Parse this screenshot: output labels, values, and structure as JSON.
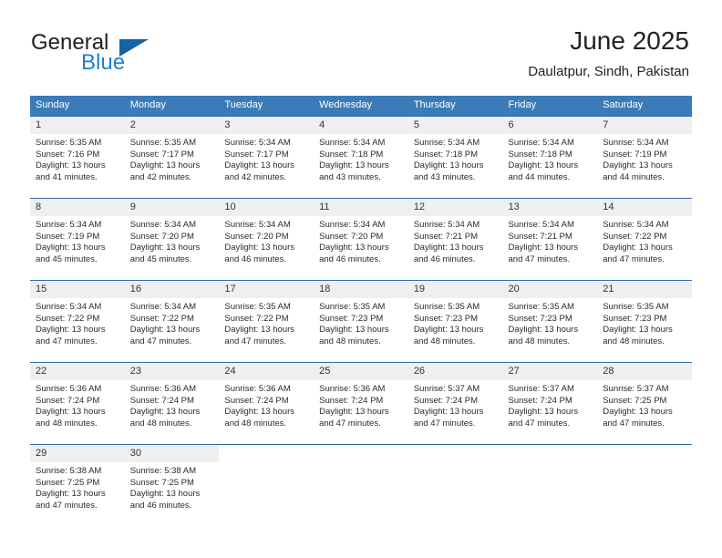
{
  "brand": {
    "name_part1": "General",
    "name_part2": "Blue",
    "triangle_color": "#1464a5",
    "blue_color": "#1f7fd0"
  },
  "header": {
    "title": "June 2025",
    "subtitle": "Daulatpur, Sindh, Pakistan"
  },
  "theme": {
    "header_row_bg": "#3b7cb8",
    "daynum_bg": "#efefef",
    "row_border": "#2f6da8"
  },
  "weekday_headers": [
    "Sunday",
    "Monday",
    "Tuesday",
    "Wednesday",
    "Thursday",
    "Friday",
    "Saturday"
  ],
  "days": [
    {
      "date": "1",
      "sunrise": "Sunrise: 5:35 AM",
      "sunset": "Sunset: 7:16 PM",
      "daylight_line1": "Daylight: 13 hours",
      "daylight_line2": "and 41 minutes."
    },
    {
      "date": "2",
      "sunrise": "Sunrise: 5:35 AM",
      "sunset": "Sunset: 7:17 PM",
      "daylight_line1": "Daylight: 13 hours",
      "daylight_line2": "and 42 minutes."
    },
    {
      "date": "3",
      "sunrise": "Sunrise: 5:34 AM",
      "sunset": "Sunset: 7:17 PM",
      "daylight_line1": "Daylight: 13 hours",
      "daylight_line2": "and 42 minutes."
    },
    {
      "date": "4",
      "sunrise": "Sunrise: 5:34 AM",
      "sunset": "Sunset: 7:18 PM",
      "daylight_line1": "Daylight: 13 hours",
      "daylight_line2": "and 43 minutes."
    },
    {
      "date": "5",
      "sunrise": "Sunrise: 5:34 AM",
      "sunset": "Sunset: 7:18 PM",
      "daylight_line1": "Daylight: 13 hours",
      "daylight_line2": "and 43 minutes."
    },
    {
      "date": "6",
      "sunrise": "Sunrise: 5:34 AM",
      "sunset": "Sunset: 7:18 PM",
      "daylight_line1": "Daylight: 13 hours",
      "daylight_line2": "and 44 minutes."
    },
    {
      "date": "7",
      "sunrise": "Sunrise: 5:34 AM",
      "sunset": "Sunset: 7:19 PM",
      "daylight_line1": "Daylight: 13 hours",
      "daylight_line2": "and 44 minutes."
    },
    {
      "date": "8",
      "sunrise": "Sunrise: 5:34 AM",
      "sunset": "Sunset: 7:19 PM",
      "daylight_line1": "Daylight: 13 hours",
      "daylight_line2": "and 45 minutes."
    },
    {
      "date": "9",
      "sunrise": "Sunrise: 5:34 AM",
      "sunset": "Sunset: 7:20 PM",
      "daylight_line1": "Daylight: 13 hours",
      "daylight_line2": "and 45 minutes."
    },
    {
      "date": "10",
      "sunrise": "Sunrise: 5:34 AM",
      "sunset": "Sunset: 7:20 PM",
      "daylight_line1": "Daylight: 13 hours",
      "daylight_line2": "and 46 minutes."
    },
    {
      "date": "11",
      "sunrise": "Sunrise: 5:34 AM",
      "sunset": "Sunset: 7:20 PM",
      "daylight_line1": "Daylight: 13 hours",
      "daylight_line2": "and 46 minutes."
    },
    {
      "date": "12",
      "sunrise": "Sunrise: 5:34 AM",
      "sunset": "Sunset: 7:21 PM",
      "daylight_line1": "Daylight: 13 hours",
      "daylight_line2": "and 46 minutes."
    },
    {
      "date": "13",
      "sunrise": "Sunrise: 5:34 AM",
      "sunset": "Sunset: 7:21 PM",
      "daylight_line1": "Daylight: 13 hours",
      "daylight_line2": "and 47 minutes."
    },
    {
      "date": "14",
      "sunrise": "Sunrise: 5:34 AM",
      "sunset": "Sunset: 7:22 PM",
      "daylight_line1": "Daylight: 13 hours",
      "daylight_line2": "and 47 minutes."
    },
    {
      "date": "15",
      "sunrise": "Sunrise: 5:34 AM",
      "sunset": "Sunset: 7:22 PM",
      "daylight_line1": "Daylight: 13 hours",
      "daylight_line2": "and 47 minutes."
    },
    {
      "date": "16",
      "sunrise": "Sunrise: 5:34 AM",
      "sunset": "Sunset: 7:22 PM",
      "daylight_line1": "Daylight: 13 hours",
      "daylight_line2": "and 47 minutes."
    },
    {
      "date": "17",
      "sunrise": "Sunrise: 5:35 AM",
      "sunset": "Sunset: 7:22 PM",
      "daylight_line1": "Daylight: 13 hours",
      "daylight_line2": "and 47 minutes."
    },
    {
      "date": "18",
      "sunrise": "Sunrise: 5:35 AM",
      "sunset": "Sunset: 7:23 PM",
      "daylight_line1": "Daylight: 13 hours",
      "daylight_line2": "and 48 minutes."
    },
    {
      "date": "19",
      "sunrise": "Sunrise: 5:35 AM",
      "sunset": "Sunset: 7:23 PM",
      "daylight_line1": "Daylight: 13 hours",
      "daylight_line2": "and 48 minutes."
    },
    {
      "date": "20",
      "sunrise": "Sunrise: 5:35 AM",
      "sunset": "Sunset: 7:23 PM",
      "daylight_line1": "Daylight: 13 hours",
      "daylight_line2": "and 48 minutes."
    },
    {
      "date": "21",
      "sunrise": "Sunrise: 5:35 AM",
      "sunset": "Sunset: 7:23 PM",
      "daylight_line1": "Daylight: 13 hours",
      "daylight_line2": "and 48 minutes."
    },
    {
      "date": "22",
      "sunrise": "Sunrise: 5:36 AM",
      "sunset": "Sunset: 7:24 PM",
      "daylight_line1": "Daylight: 13 hours",
      "daylight_line2": "and 48 minutes."
    },
    {
      "date": "23",
      "sunrise": "Sunrise: 5:36 AM",
      "sunset": "Sunset: 7:24 PM",
      "daylight_line1": "Daylight: 13 hours",
      "daylight_line2": "and 48 minutes."
    },
    {
      "date": "24",
      "sunrise": "Sunrise: 5:36 AM",
      "sunset": "Sunset: 7:24 PM",
      "daylight_line1": "Daylight: 13 hours",
      "daylight_line2": "and 48 minutes."
    },
    {
      "date": "25",
      "sunrise": "Sunrise: 5:36 AM",
      "sunset": "Sunset: 7:24 PM",
      "daylight_line1": "Daylight: 13 hours",
      "daylight_line2": "and 47 minutes."
    },
    {
      "date": "26",
      "sunrise": "Sunrise: 5:37 AM",
      "sunset": "Sunset: 7:24 PM",
      "daylight_line1": "Daylight: 13 hours",
      "daylight_line2": "and 47 minutes."
    },
    {
      "date": "27",
      "sunrise": "Sunrise: 5:37 AM",
      "sunset": "Sunset: 7:24 PM",
      "daylight_line1": "Daylight: 13 hours",
      "daylight_line2": "and 47 minutes."
    },
    {
      "date": "28",
      "sunrise": "Sunrise: 5:37 AM",
      "sunset": "Sunset: 7:25 PM",
      "daylight_line1": "Daylight: 13 hours",
      "daylight_line2": "and 47 minutes."
    },
    {
      "date": "29",
      "sunrise": "Sunrise: 5:38 AM",
      "sunset": "Sunset: 7:25 PM",
      "daylight_line1": "Daylight: 13 hours",
      "daylight_line2": "and 47 minutes."
    },
    {
      "date": "30",
      "sunrise": "Sunrise: 5:38 AM",
      "sunset": "Sunset: 7:25 PM",
      "daylight_line1": "Daylight: 13 hours",
      "daylight_line2": "and 46 minutes."
    }
  ],
  "grid": {
    "leading_blanks": 0,
    "trailing_blanks": 5,
    "columns": 7
  }
}
